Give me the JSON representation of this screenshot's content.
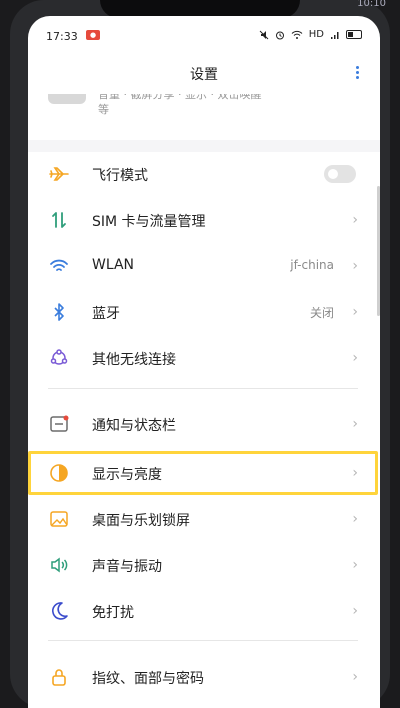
{
  "topbar": {
    "right_time": "10:10"
  },
  "status": {
    "time": "17:33",
    "rec_label": "●",
    "hd": "HD"
  },
  "header": {
    "title": "设置"
  },
  "partial": {
    "line1": "音量 · 截屏分享 · 显示 · 双击唤醒",
    "line2": "等"
  },
  "rows": [
    {
      "label": "飞行模式",
      "value": "",
      "icon": "airplane-icon"
    },
    {
      "label": "SIM 卡与流量管理",
      "value": "",
      "icon": "sim-transfer-icon"
    },
    {
      "label": "WLAN",
      "value": "jf-china",
      "icon": "wifi-icon"
    },
    {
      "label": "蓝牙",
      "value": "关闭",
      "icon": "bluetooth-icon"
    },
    {
      "label": "其他无线连接",
      "value": "",
      "icon": "wireless-network-icon"
    },
    {
      "label": "通知与状态栏",
      "value": "",
      "icon": "notification-icon"
    },
    {
      "label": "显示与亮度",
      "value": "",
      "icon": "brightness-icon"
    },
    {
      "label": "桌面与乐划锁屏",
      "value": "",
      "icon": "wallpaper-icon"
    },
    {
      "label": "声音与振动",
      "value": "",
      "icon": "sound-icon"
    },
    {
      "label": "免打扰",
      "value": "",
      "icon": "moon-icon"
    },
    {
      "label": "指纹、面部与密码",
      "value": "",
      "icon": "lock-icon"
    }
  ],
  "chevron": "›",
  "colors": {
    "accent": "#3b7ddd",
    "highlight": "#ffd43b",
    "orange": "#f5a623"
  }
}
